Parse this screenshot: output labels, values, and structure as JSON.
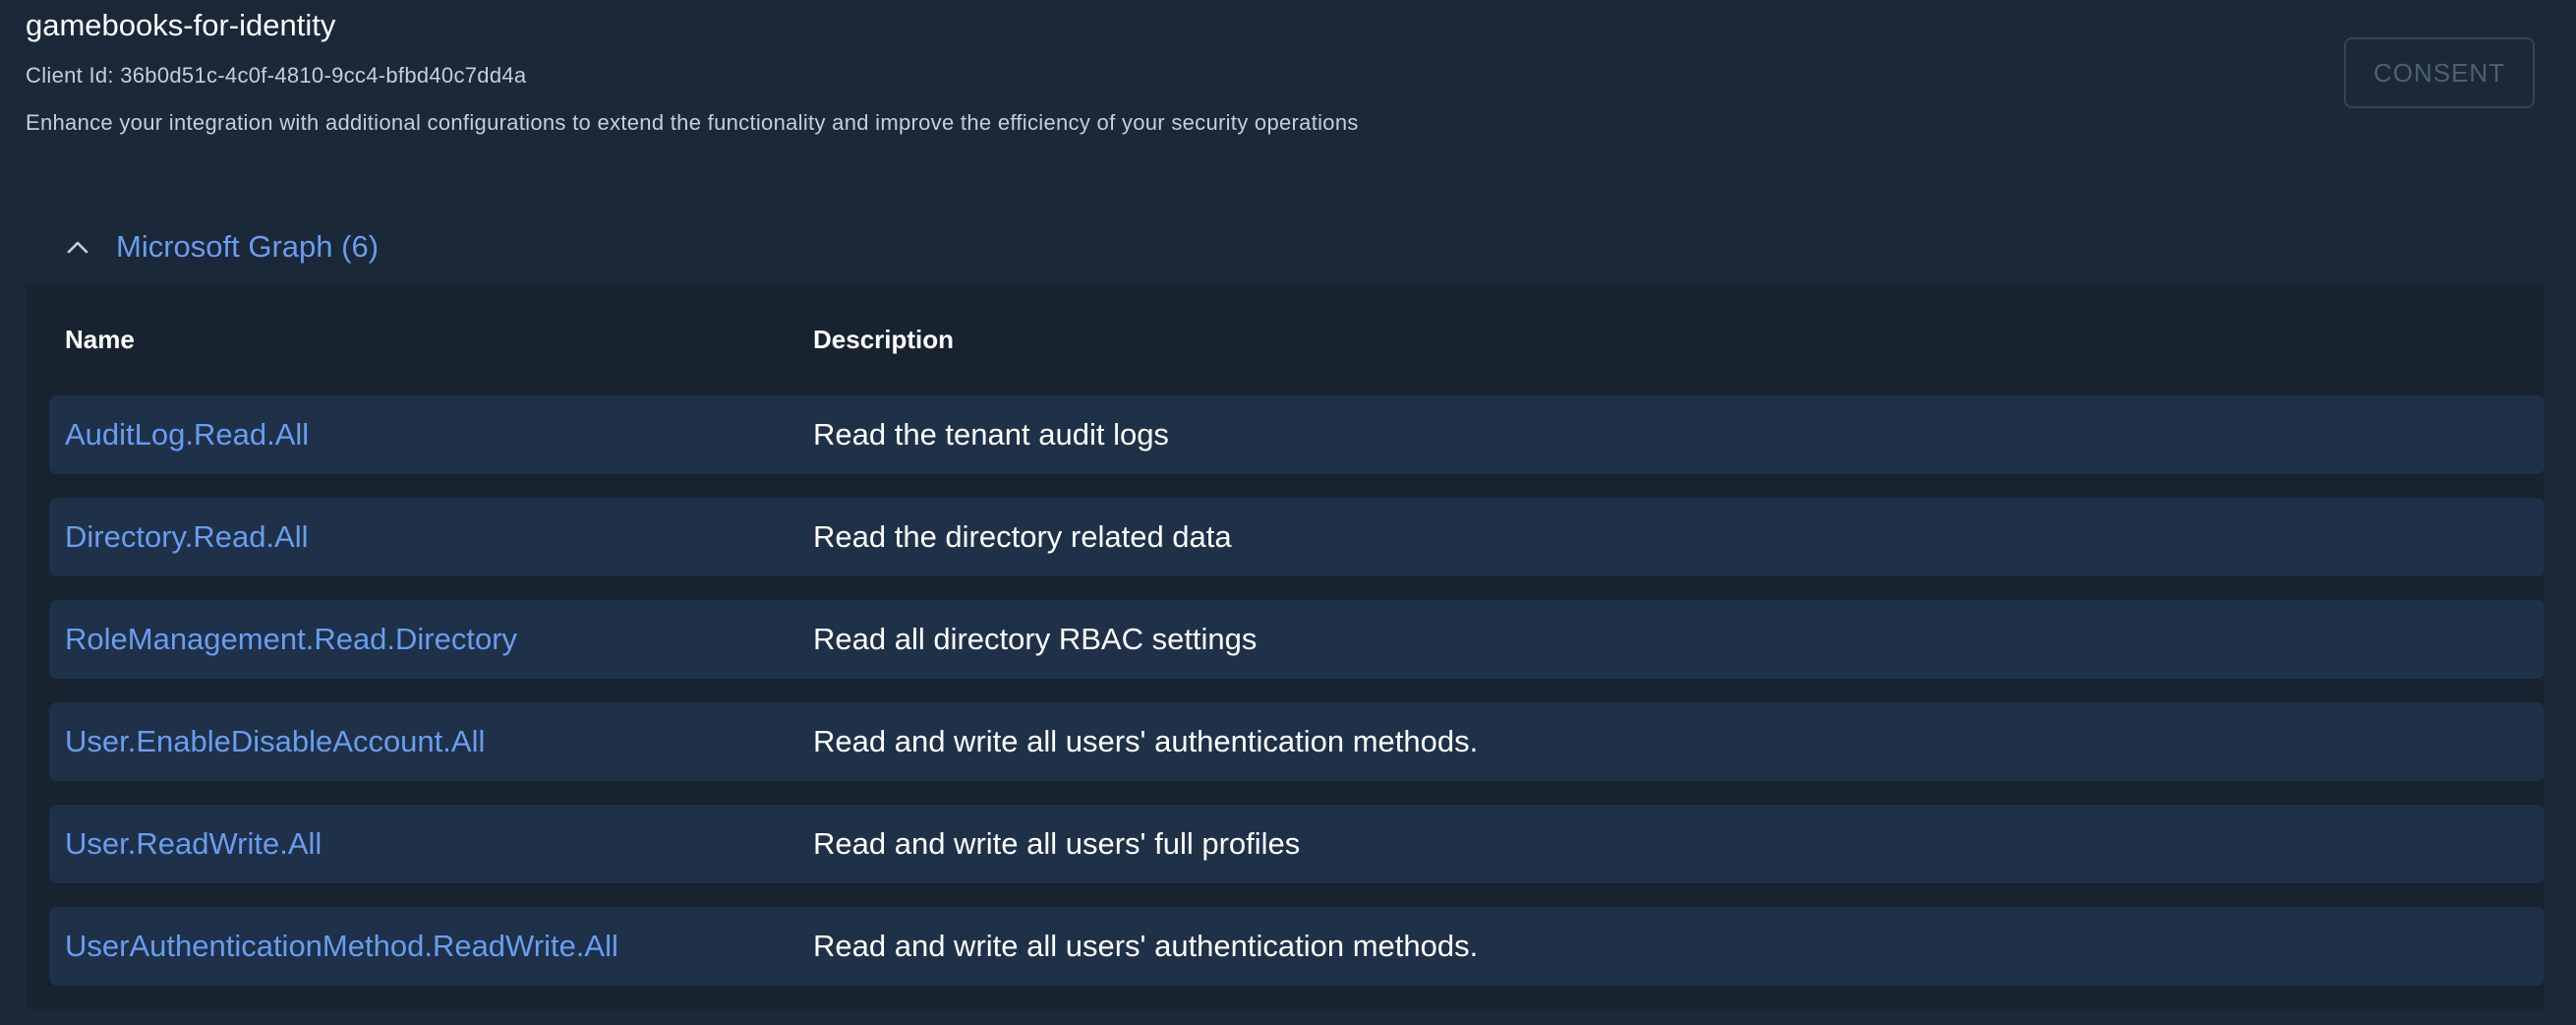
{
  "app": {
    "title": "gamebooks-for-identity",
    "client_id": "Client Id: 36b0d51c-4c0f-4810-9cc4-bfbd40c7dd4a",
    "subtitle": "Enhance your integration with additional configurations to extend the functionality and improve the efficiency of your security operations"
  },
  "toolbar": {
    "consent_label": "CONSENT"
  },
  "section": {
    "title": "Microsoft Graph (6)",
    "chevron_icon": "chevron-up-icon",
    "accent_color": "#6a9cf0"
  },
  "table": {
    "headers": {
      "name": "Name",
      "description": "Description"
    },
    "rows": [
      {
        "name": "AuditLog.Read.All",
        "description": "Read the tenant audit logs"
      },
      {
        "name": "Directory.Read.All",
        "description": "Read the directory related data"
      },
      {
        "name": "RoleManagement.Read.Directory",
        "description": "Read all directory RBAC settings"
      },
      {
        "name": "User.EnableDisableAccount.All",
        "description": "Read and write all users' authentication methods."
      },
      {
        "name": "User.ReadWrite.All",
        "description": "Read and write all users' full profiles"
      },
      {
        "name": "UserAuthenticationMethod.ReadWrite.All",
        "description": "Read and write all users' authentication methods."
      }
    ]
  }
}
